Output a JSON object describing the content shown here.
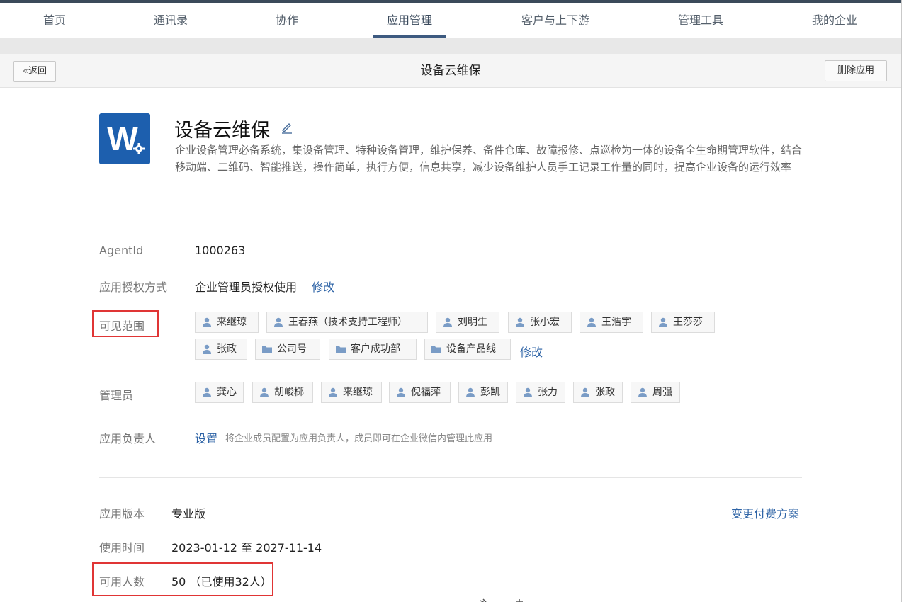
{
  "nav": {
    "items": [
      "首页",
      "通讯录",
      "协作",
      "应用管理",
      "客户与上下游",
      "管理工具",
      "我的企业"
    ],
    "active_index": 3
  },
  "titlebar": {
    "back_label": "返回",
    "title": "设备云维保",
    "delete_label": "删除应用"
  },
  "app": {
    "icon_letter": "W",
    "name": "设备云维保",
    "description": "企业设备管理必备系统，集设备管理、特种设备管理，维护保养、备件仓库、故障报修、点巡检为一体的设备全生命期管理软件，结合移动端、二维码、智能推送，操作简单，执行方便，信息共享，减少设备维护人员手工记录工作量的同时，提高企业设备的运行效率"
  },
  "details": {
    "agentid_label": "AgentId",
    "agentid_value": "1000263",
    "auth_label": "应用授权方式",
    "auth_value": "企业管理员授权使用",
    "auth_modify": "修改",
    "visible_label": "可见范围",
    "visible_tags": [
      {
        "type": "person",
        "text": "来继琼"
      },
      {
        "type": "person",
        "text": "王春燕（技术支持工程师）"
      },
      {
        "type": "person",
        "text": "刘明生"
      },
      {
        "type": "person",
        "text": "张小宏"
      },
      {
        "type": "person",
        "text": "王浩宇"
      },
      {
        "type": "person",
        "text": "王莎莎"
      },
      {
        "type": "person",
        "text": "张政"
      },
      {
        "type": "folder",
        "text": "公司号"
      },
      {
        "type": "folder",
        "text": "客户成功部"
      },
      {
        "type": "folder",
        "text": "设备产品线"
      }
    ],
    "visible_modify": "修改",
    "admin_label": "管理员",
    "admin_tags": [
      "龚心",
      "胡峻榔",
      "来继琼",
      "倪福萍",
      "彭凯",
      "张力",
      "张政",
      "周强"
    ],
    "owner_label": "应用负责人",
    "owner_link": "设置",
    "owner_note": "将企业成员配置为应用负责人，成员即可在企业微信内管理此应用"
  },
  "plan": {
    "version_label": "应用版本",
    "version_value": "专业版",
    "change_plan": "变更付费方案",
    "period_label": "使用时间",
    "period_value": "2023-01-12 至 2027-11-14",
    "seats_label": "可用人数",
    "seats_value": "50 （已使用32人）"
  },
  "colors": {
    "accent": "#2d63a6",
    "nav_underline": "#3d5a80",
    "highlight": "#e03535",
    "icon_blue": "#1d5fae",
    "tag_icon": "#7a9cc6"
  },
  "icons": {
    "back": "double-chevron-left-icon",
    "edit": "pencil-icon",
    "person": "person-icon",
    "folder": "folder-icon"
  }
}
